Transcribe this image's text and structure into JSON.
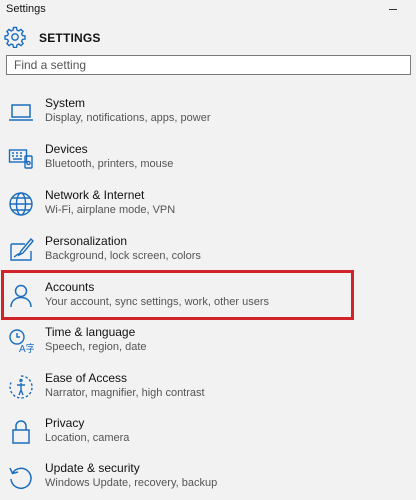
{
  "window": {
    "title": "Settings"
  },
  "header": {
    "title": "SETTINGS",
    "icon": "gear-icon"
  },
  "search": {
    "placeholder": "Find a setting",
    "value": ""
  },
  "accent_color": "#1a6dbf",
  "highlight_color": "#d1232a",
  "items": [
    {
      "label": "System",
      "description": "Display, notifications, apps, power",
      "icon": "laptop-icon"
    },
    {
      "label": "Devices",
      "description": "Bluetooth, printers, mouse",
      "icon": "keyboard-icon"
    },
    {
      "label": "Network & Internet",
      "description": "Wi-Fi, airplane mode, VPN",
      "icon": "globe-icon"
    },
    {
      "label": "Personalization",
      "description": "Background, lock screen, colors",
      "icon": "paintbrush-icon"
    },
    {
      "label": "Accounts",
      "description": "Your account, sync settings, work, other users",
      "icon": "person-icon",
      "highlighted": true
    },
    {
      "label": "Time & language",
      "description": "Speech, region, date",
      "icon": "time-language-icon"
    },
    {
      "label": "Ease of Access",
      "description": "Narrator, magnifier, high contrast",
      "icon": "ease-of-access-icon"
    },
    {
      "label": "Privacy",
      "description": "Location, camera",
      "icon": "lock-icon"
    },
    {
      "label": "Update & security",
      "description": "Windows Update, recovery, backup",
      "icon": "update-icon"
    }
  ]
}
